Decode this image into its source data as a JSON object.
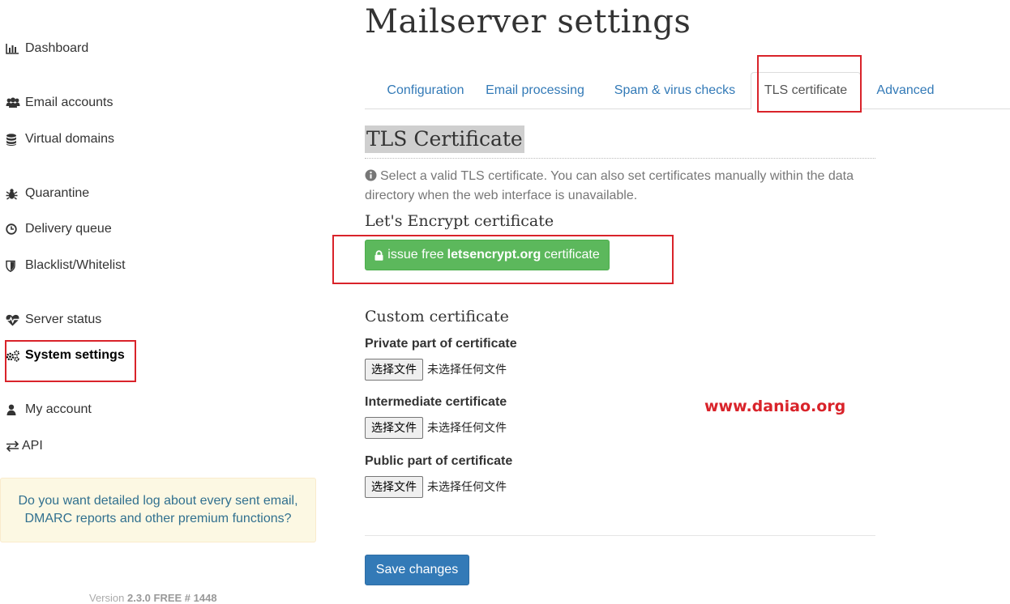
{
  "sidebar": {
    "items": [
      {
        "label": "Dashboard",
        "icon": "bar-chart-icon"
      },
      {
        "label": "Email accounts",
        "icon": "users-icon"
      },
      {
        "label": "Virtual domains",
        "icon": "database-icon"
      },
      {
        "label": "Quarantine",
        "icon": "bug-icon"
      },
      {
        "label": "Delivery queue",
        "icon": "clock-icon"
      },
      {
        "label": "Blacklist/Whitelist",
        "icon": "shield-icon"
      },
      {
        "label": "Server status",
        "icon": "heartbeat-icon"
      },
      {
        "label": "System settings",
        "icon": "cogs-icon",
        "active": true
      },
      {
        "label": "My account",
        "icon": "user-icon"
      },
      {
        "label": "API",
        "icon": "exchange-icon"
      }
    ],
    "premium_notice": "Do you want detailed log about every sent email, DMARC reports and other premium functions?",
    "version_prefix": "Version",
    "version_value": "2.3.0 FREE # 1448"
  },
  "main": {
    "page_title": "Mailserver settings",
    "tabs": [
      {
        "label": "Configuration"
      },
      {
        "label": "Email processing"
      },
      {
        "label": "Spam & virus checks"
      },
      {
        "label": "TLS certificate",
        "active": true
      },
      {
        "label": "Advanced"
      }
    ],
    "section_title": "TLS Certificate",
    "info_text": "Select a valid TLS certificate. You can also set certificates manually within the data directory when the web interface is unavailable.",
    "letsencrypt": {
      "title": "Let's Encrypt certificate",
      "button_prefix": "issue free",
      "button_bold": "letsencrypt.org",
      "button_suffix": "certificate"
    },
    "custom": {
      "title": "Custom certificate",
      "fields": [
        {
          "label": "Private part of certificate",
          "button": "选择文件",
          "status": "未选择任何文件"
        },
        {
          "label": "Intermediate certificate",
          "button": "选择文件",
          "status": "未选择任何文件"
        },
        {
          "label": "Public part of certificate",
          "button": "选择文件",
          "status": "未选择任何文件"
        }
      ]
    },
    "save_label": "Save changes",
    "watermark": "www.daniao.org"
  },
  "colors": {
    "link_blue": "#337ab7",
    "success_green": "#5cb85c",
    "highlight_red": "#d9232a",
    "notice_bg": "#fcf8e3"
  }
}
